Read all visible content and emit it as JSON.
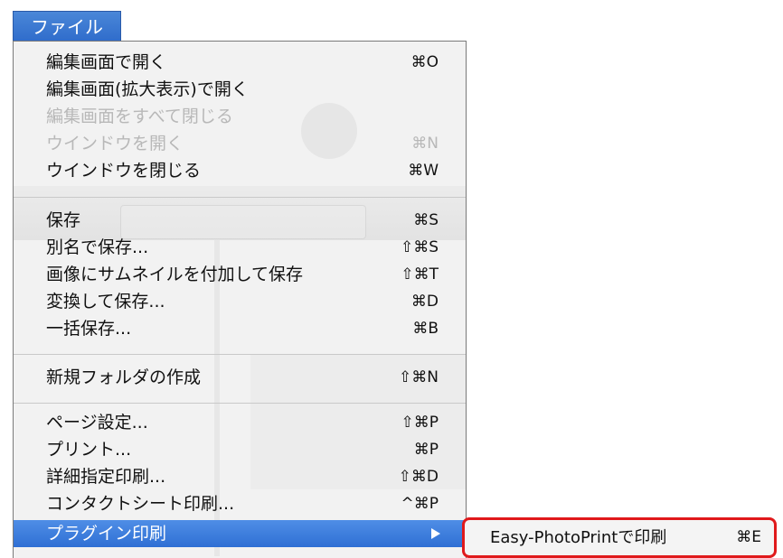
{
  "menu_title": "ファイル",
  "menu": {
    "groups": [
      [
        {
          "label": "編集画面で開く",
          "shortcut": "⌘O",
          "enabled": true
        },
        {
          "label": "編集画面(拡大表示)で開く",
          "shortcut": "",
          "enabled": true
        },
        {
          "label": "編集画面をすべて閉じる",
          "shortcut": "",
          "enabled": false
        },
        {
          "label": "ウインドウを開く",
          "shortcut": "⌘N",
          "enabled": false
        },
        {
          "label": "ウインドウを閉じる",
          "shortcut": "⌘W",
          "enabled": true
        }
      ],
      [
        {
          "label": "保存",
          "shortcut": "⌘S",
          "enabled": true
        },
        {
          "label": "別名で保存...",
          "shortcut": "⇧⌘S",
          "enabled": true
        },
        {
          "label": "画像にサムネイルを付加して保存",
          "shortcut": "⇧⌘T",
          "enabled": true
        },
        {
          "label": "変換して保存...",
          "shortcut": "⌘D",
          "enabled": true
        },
        {
          "label": "一括保存...",
          "shortcut": "⌘B",
          "enabled": true
        }
      ],
      [
        {
          "label": "新規フォルダの作成",
          "shortcut": "⇧⌘N",
          "enabled": true
        }
      ],
      [
        {
          "label": "ページ設定...",
          "shortcut": "⇧⌘P",
          "enabled": true
        },
        {
          "label": "プリント...",
          "shortcut": "⌘P",
          "enabled": true
        },
        {
          "label": "詳細指定印刷...",
          "shortcut": "⇧⌘D",
          "enabled": true
        },
        {
          "label": "コンタクトシート印刷...",
          "shortcut": "^⌘P",
          "enabled": true
        },
        {
          "label": "プラグイン印刷",
          "shortcut": "",
          "enabled": true,
          "highlighted": true,
          "has_submenu": true
        }
      ]
    ]
  },
  "submenu": {
    "label": "Easy-PhotoPrintで印刷",
    "shortcut": "⌘E"
  },
  "colors": {
    "highlight": "#2f6fd4",
    "annotation_border": "#e0191b"
  }
}
